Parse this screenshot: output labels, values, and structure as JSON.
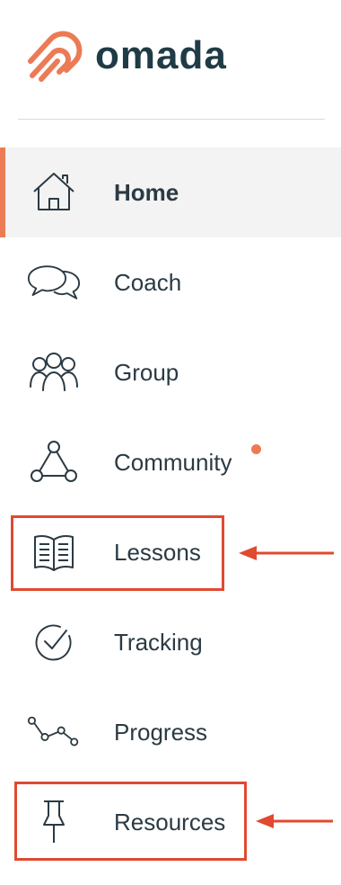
{
  "brand": {
    "name": "omada",
    "logo_icon": "omada-logo-icon",
    "accent_color": "#ec7b55",
    "text_color": "#1f3b46"
  },
  "nav": {
    "active": "Home",
    "items": [
      {
        "label": "Home",
        "icon": "house-icon",
        "active": true
      },
      {
        "label": "Coach",
        "icon": "chat-bubbles-icon"
      },
      {
        "label": "Group",
        "icon": "people-icon"
      },
      {
        "label": "Community",
        "icon": "network-triangle-icon",
        "has_notification": true
      },
      {
        "label": "Lessons",
        "icon": "book-icon",
        "highlighted": true
      },
      {
        "label": "Tracking",
        "icon": "check-circle-icon"
      },
      {
        "label": "Progress",
        "icon": "line-chart-icon"
      },
      {
        "label": "Resources",
        "icon": "pushpin-icon",
        "highlighted": true
      }
    ]
  },
  "annotations": {
    "highlight_color": "#e04a2f",
    "highlighted_items": [
      "Lessons",
      "Resources"
    ]
  }
}
